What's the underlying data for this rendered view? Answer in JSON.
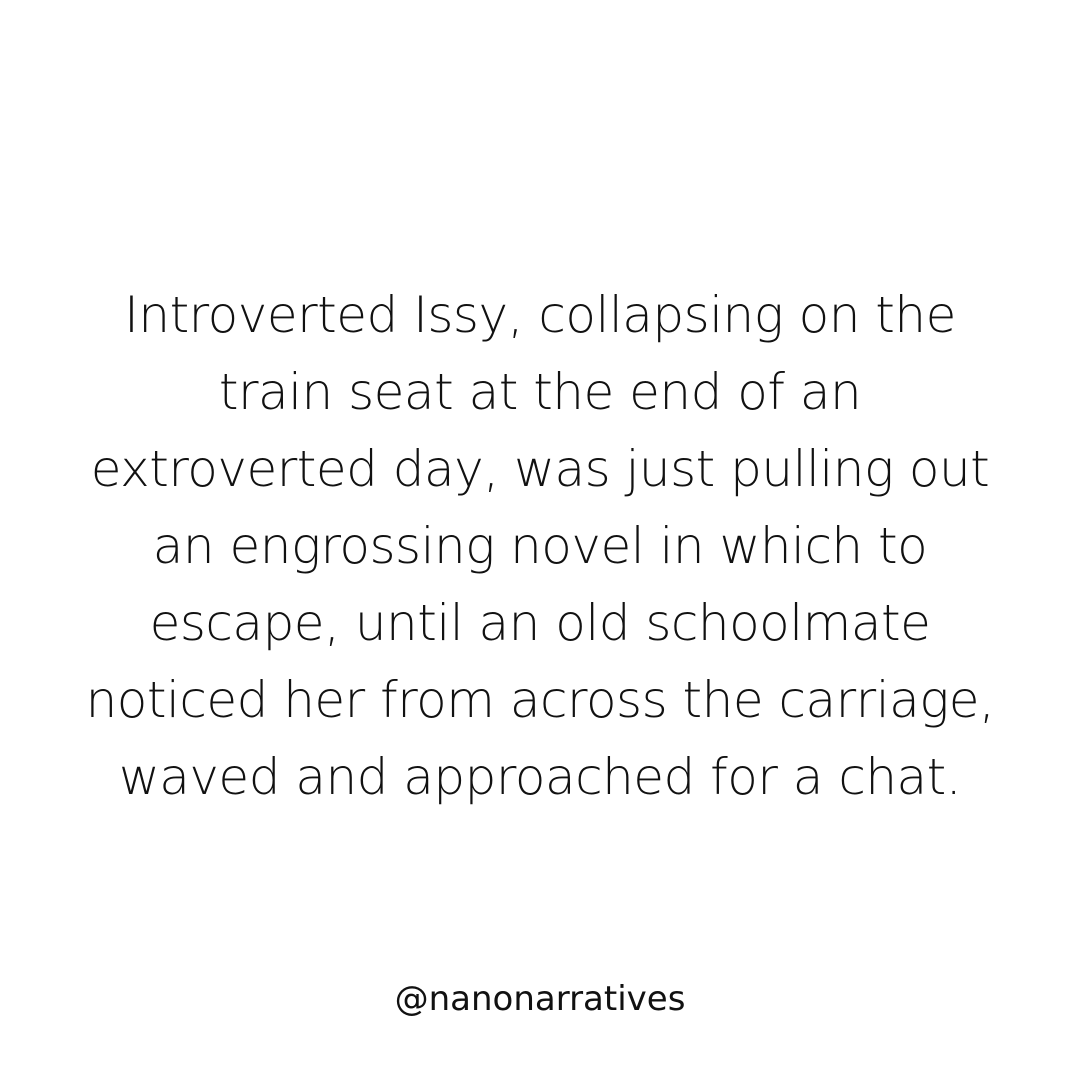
{
  "story": {
    "lines": [
      "Introverted Issy, collapsing on the",
      "train seat at the end of an",
      "extroverted day, was just pulling out",
      "an engrossing novel in which to",
      "escape, until an old schoolmate",
      "noticed her from across the carriage,",
      "waved and approached for a chat."
    ]
  },
  "footer": {
    "handle": "@nanonarratives"
  },
  "colors": {
    "background": "#ffffff",
    "text": "#111111"
  }
}
